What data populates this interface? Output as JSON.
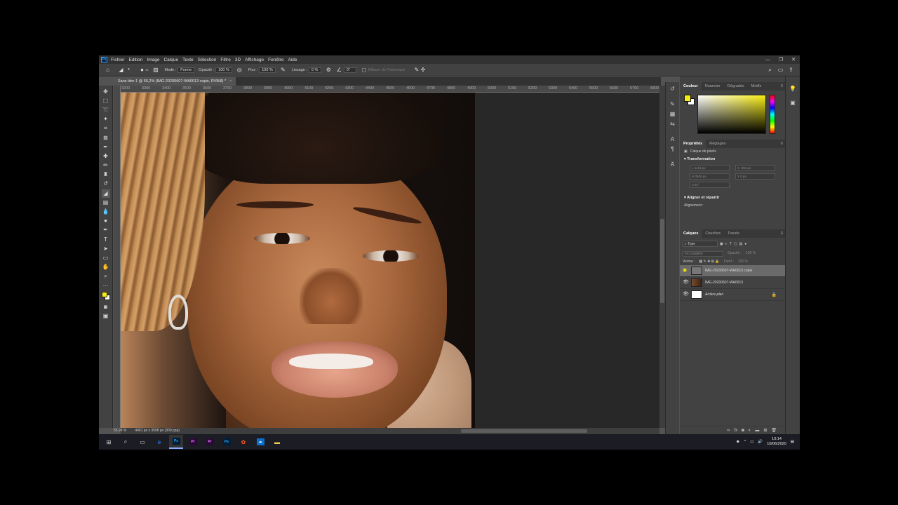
{
  "app": {
    "logo": "Ps",
    "menu": [
      "Fichier",
      "Edition",
      "Image",
      "Calque",
      "Texte",
      "Sélection",
      "Filtre",
      "3D",
      "Affichage",
      "Fenêtre",
      "Aide"
    ],
    "window_controls": [
      "—",
      "❐",
      "✕"
    ]
  },
  "options": {
    "brush_size": "76",
    "mode_label": "Mode :",
    "mode_value": "Forme",
    "opacity_label": "Opacité :",
    "opacity_value": "100 %",
    "flow_label": "Flux :",
    "flow_value": "100 %",
    "smoothing_label": "Lissage :",
    "smoothing_value": "0 %",
    "angle_value": "0°",
    "history_label": "Effacer de l'historique"
  },
  "document": {
    "tab_title": "Sans titre-1 @ 55,2% (IMG-20200607-WA0013 copie, RVB/8) *",
    "tab_close": "×",
    "zoom": "55,24 %",
    "doc_size": "4461 px x 3508 px (300 ppp)",
    "ruler_ticks": [
      "3200",
      "3300",
      "3400",
      "3500",
      "3600",
      "3700",
      "3800",
      "3900",
      "4000",
      "4100",
      "4200",
      "4300",
      "4400",
      "4500",
      "4600",
      "4700",
      "4800",
      "4900",
      "5000",
      "5100",
      "5200",
      "5300",
      "5400",
      "5500",
      "5600",
      "5700",
      "5800"
    ]
  },
  "color_panel": {
    "tabs": [
      "Couleur",
      "Nuancier",
      "Dégradés",
      "Motifs"
    ],
    "foreground": "#f6ec10",
    "background": "#ffffff"
  },
  "props_panel": {
    "tabs": [
      "Propriétés",
      "Réglages"
    ],
    "layer_type": "Calque de pixels",
    "transform_label": "Transformation",
    "fields": [
      "L  4461 px",
      "X  -656 px",
      "H  3508 px",
      "Y  0 px",
      "0,00°",
      ""
    ],
    "align_label": "Aligner et répartir",
    "alignment_label": "Alignement :"
  },
  "layers_panel": {
    "tabs": [
      "Calques",
      "Couches",
      "Tracés"
    ],
    "filter_type": "Type",
    "blend_mode": "Incrustation",
    "opacity_label": "Opacité :",
    "opacity_value": "100 %",
    "lock_label": "Verrou :",
    "fill_label": "Fond :",
    "fill_value": "100 %",
    "layers": [
      {
        "name": "IMG-20200607-WA0013 copie"
      },
      {
        "name": "IMG-20200607-WA0013"
      },
      {
        "name": "Arrière-plan"
      }
    ]
  },
  "taskbar": {
    "time": "10:14",
    "date": "10/06/2020",
    "apps": [
      "Ps",
      "Pr",
      "Pr",
      "Ps"
    ]
  }
}
